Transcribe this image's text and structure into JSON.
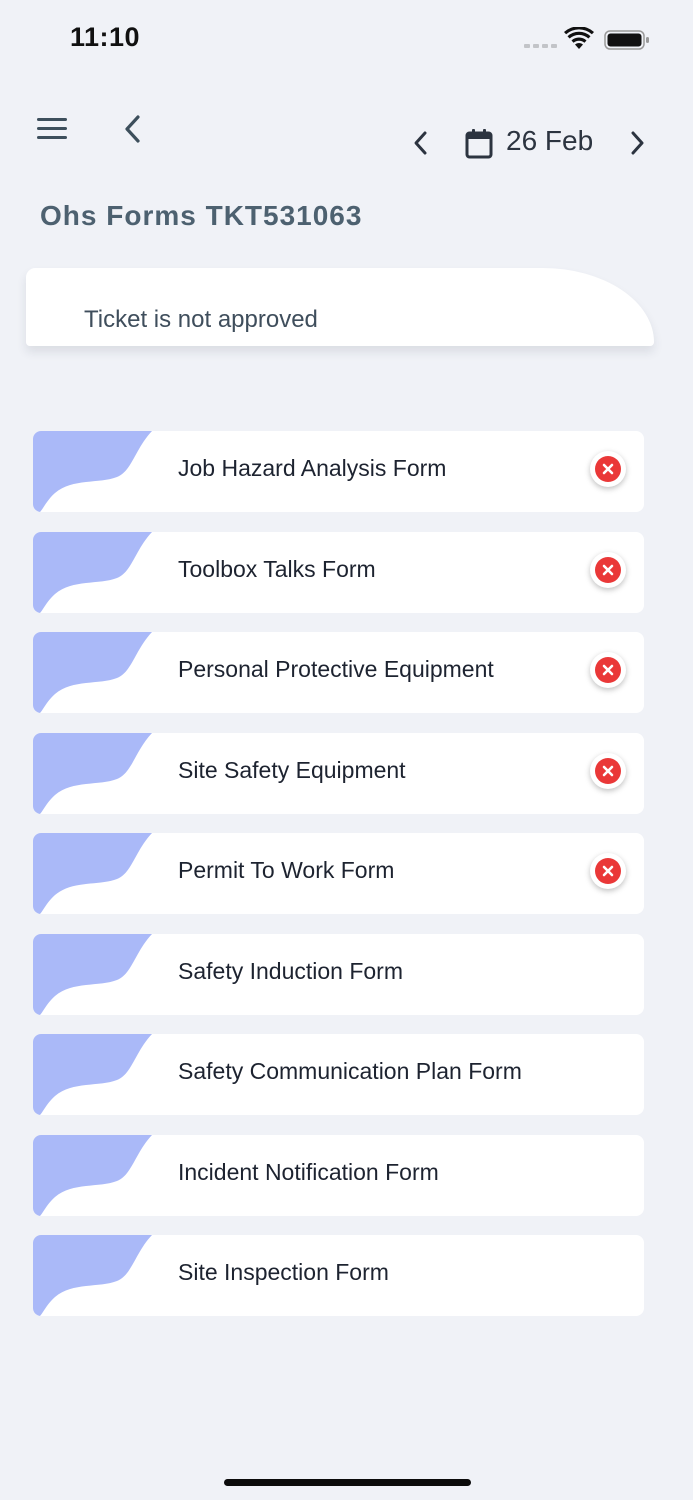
{
  "status_bar": {
    "time": "11:10"
  },
  "header": {
    "menu_icon": "hamburger-icon",
    "back_icon": "chevron-left-icon",
    "date_prev_icon": "chevron-left-icon",
    "calendar_icon": "calendar-icon",
    "date": "26 Feb",
    "date_next_icon": "chevron-right-icon"
  },
  "page": {
    "title": "Ohs Forms TKT531063"
  },
  "ticket": {
    "status_text": "Ticket is not approved"
  },
  "colors": {
    "background": "#f0f2f7",
    "card": "#ffffff",
    "wave": "#aab9f8",
    "error_red": "#ea3838",
    "title": "#4d6170"
  },
  "forms": [
    {
      "label": "Job Hazard Analysis Form",
      "status": "incomplete"
    },
    {
      "label": "Toolbox Talks Form",
      "status": "incomplete"
    },
    {
      "label": "Personal Protective Equipment",
      "status": "incomplete"
    },
    {
      "label": "Site Safety Equipment",
      "status": "incomplete"
    },
    {
      "label": "Permit To Work Form",
      "status": "incomplete"
    },
    {
      "label": "Safety Induction Form",
      "status": "none"
    },
    {
      "label": "Safety Communication Plan Form",
      "status": "none"
    },
    {
      "label": "Incident Notification Form",
      "status": "none"
    },
    {
      "label": "Site Inspection Form",
      "status": "none"
    }
  ]
}
